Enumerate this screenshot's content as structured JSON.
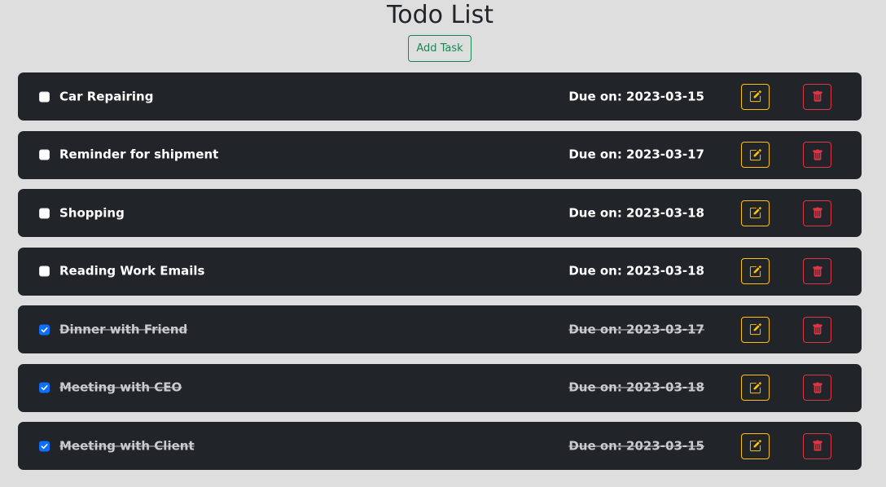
{
  "header": {
    "title": "Todo List",
    "add_button_label": "Add Task"
  },
  "colors": {
    "background": "#dedede",
    "card": "#212529",
    "add_button": "#198754",
    "edit_button": "#ffc107",
    "delete_button": "#dc3545",
    "checkbox_checked": "#0d6efd"
  },
  "icons": {
    "edit": "pencil-square-icon",
    "delete": "trash-icon",
    "checked": "checkmark-icon"
  },
  "tasks": [
    {
      "name": "Car Repairing",
      "due": "Due on: 2023-03-15",
      "completed": false
    },
    {
      "name": "Reminder for shipment",
      "due": "Due on: 2023-03-17",
      "completed": false
    },
    {
      "name": "Shopping",
      "due": "Due on: 2023-03-18",
      "completed": false
    },
    {
      "name": "Reading Work Emails",
      "due": "Due on: 2023-03-18",
      "completed": false
    },
    {
      "name": "Dinner with Friend",
      "due": "Due on: 2023-03-17",
      "completed": true
    },
    {
      "name": "Meeting with CEO",
      "due": "Due on: 2023-03-18",
      "completed": true
    },
    {
      "name": "Meeting with Client",
      "due": "Due on: 2023-03-15",
      "completed": true
    }
  ]
}
